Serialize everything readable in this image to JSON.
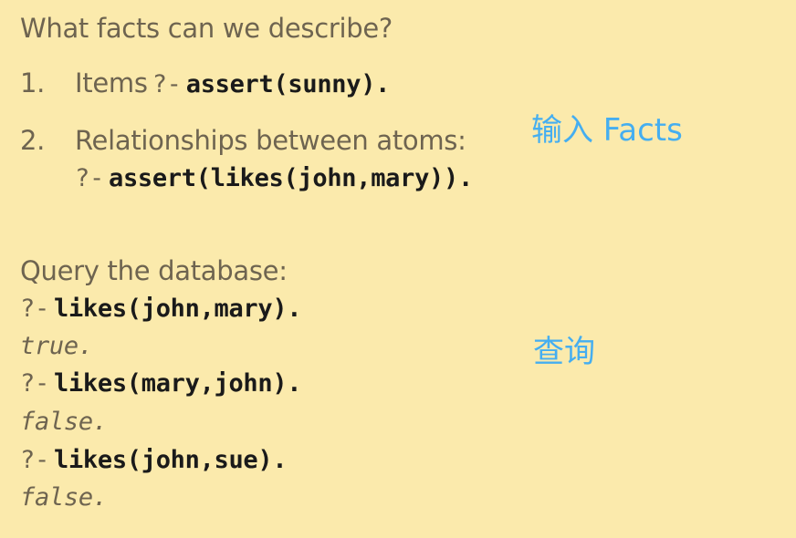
{
  "facts": {
    "heading": "What facts can we describe?",
    "item1": {
      "number": "1.",
      "label": "Items",
      "prompt": "?-",
      "code": "assert(sunny)."
    },
    "item2": {
      "number": "2.",
      "label": "Relationships between atoms:",
      "prompt": "?-",
      "code": "assert(likes(john,mary))."
    }
  },
  "query": {
    "heading": "Query the database:",
    "entries": [
      {
        "prompt": "?-",
        "code": "likes(john,mary).",
        "result": "true."
      },
      {
        "prompt": "?-",
        "code": "likes(mary,john).",
        "result": "false."
      },
      {
        "prompt": "?-",
        "code": "likes(john,sue).",
        "result": "false."
      }
    ]
  },
  "annotations": {
    "facts_note": "输入 Facts",
    "query_note": "查询",
    "color": "#45aef0"
  },
  "colors": {
    "background": "#fbeaac",
    "text": "#6e6450",
    "code": "#1a1a1a"
  }
}
